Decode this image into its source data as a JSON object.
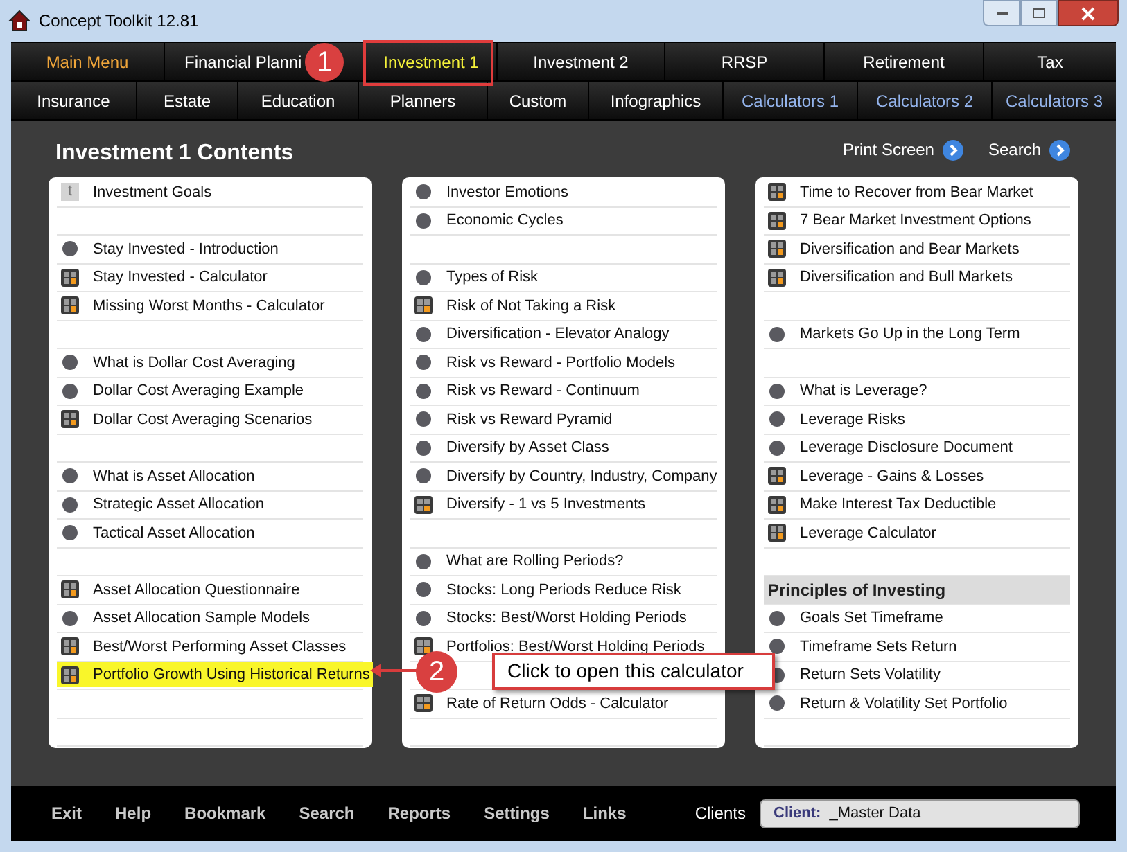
{
  "window": {
    "title": "Concept Toolkit 12.81"
  },
  "tab_rows": [
    [
      {
        "label": "Main Menu",
        "kind": "main",
        "selected": false
      },
      {
        "label": "Financial Planni",
        "kind": "normal",
        "selected": false
      },
      {
        "label": "Investment 1",
        "kind": "normal",
        "selected": true
      },
      {
        "label": "Investment 2",
        "kind": "normal",
        "selected": false
      },
      {
        "label": "RRSP",
        "kind": "normal",
        "selected": false
      },
      {
        "label": "Retirement",
        "kind": "normal",
        "selected": false
      },
      {
        "label": "Tax",
        "kind": "normal",
        "selected": false
      }
    ],
    [
      {
        "label": "Insurance",
        "kind": "normal",
        "selected": false
      },
      {
        "label": "Estate",
        "kind": "normal",
        "selected": false
      },
      {
        "label": "Education",
        "kind": "normal",
        "selected": false
      },
      {
        "label": "Planners",
        "kind": "normal",
        "selected": false
      },
      {
        "label": "Custom",
        "kind": "normal",
        "selected": false
      },
      {
        "label": "Infographics",
        "kind": "normal",
        "selected": false
      },
      {
        "label": "Calculators 1",
        "kind": "calculator",
        "selected": false
      },
      {
        "label": "Calculators 2",
        "kind": "calculator",
        "selected": false
      },
      {
        "label": "Calculators 3",
        "kind": "calculator",
        "selected": false
      }
    ]
  ],
  "content": {
    "title": "Investment 1 Contents",
    "actions": [
      "Print Screen",
      "Search"
    ]
  },
  "columns": [
    [
      {
        "kind": "note",
        "icon_text": "t",
        "label": "Investment Goals",
        "selected": false
      },
      {
        "kind": "blank"
      },
      {
        "kind": "page",
        "label": "Stay Invested - Introduction",
        "selected": false
      },
      {
        "kind": "calculator",
        "label": "Stay Invested - Calculator",
        "selected": false
      },
      {
        "kind": "calculator",
        "label": "Missing Worst Months - Calculator",
        "selected": false
      },
      {
        "kind": "blank"
      },
      {
        "kind": "page",
        "label": "What is Dollar Cost Averaging",
        "selected": false
      },
      {
        "kind": "page",
        "label": "Dollar Cost Averaging Example",
        "selected": false
      },
      {
        "kind": "calculator",
        "label": "Dollar Cost Averaging Scenarios",
        "selected": false
      },
      {
        "kind": "blank"
      },
      {
        "kind": "page",
        "label": "What is Asset Allocation",
        "selected": false
      },
      {
        "kind": "page",
        "label": "Strategic Asset Allocation",
        "selected": false
      },
      {
        "kind": "page",
        "label": "Tactical Asset Allocation",
        "selected": false
      },
      {
        "kind": "blank"
      },
      {
        "kind": "calculator",
        "label": "Asset Allocation Questionnaire",
        "selected": false
      },
      {
        "kind": "page",
        "label": "Asset Allocation Sample Models",
        "selected": false
      },
      {
        "kind": "calculator",
        "label": "Best/Worst Performing Asset Classes",
        "selected": false
      },
      {
        "kind": "calculator",
        "label": "Portfolio Growth Using Historical Returns",
        "selected": true
      },
      {
        "kind": "blank"
      },
      {
        "kind": "blank"
      }
    ],
    [
      {
        "kind": "page",
        "label": "Investor Emotions",
        "selected": false
      },
      {
        "kind": "page",
        "label": "Economic Cycles",
        "selected": false
      },
      {
        "kind": "blank"
      },
      {
        "kind": "page",
        "label": "Types of Risk",
        "selected": false
      },
      {
        "kind": "calculator",
        "label": "Risk of Not Taking a Risk",
        "selected": false
      },
      {
        "kind": "page",
        "label": "Diversification - Elevator Analogy",
        "selected": false
      },
      {
        "kind": "page",
        "label": "Risk vs Reward - Portfolio Models",
        "selected": false
      },
      {
        "kind": "page",
        "label": "Risk vs Reward - Continuum",
        "selected": false
      },
      {
        "kind": "page",
        "label": "Risk vs Reward Pyramid",
        "selected": false
      },
      {
        "kind": "page",
        "label": "Diversify by Asset Class",
        "selected": false
      },
      {
        "kind": "page",
        "label": "Diversify by Country, Industry, Company",
        "selected": false
      },
      {
        "kind": "calculator",
        "label": "Diversify - 1 vs 5 Investments",
        "selected": false
      },
      {
        "kind": "blank"
      },
      {
        "kind": "page",
        "label": "What are Rolling Periods?",
        "selected": false
      },
      {
        "kind": "page",
        "label": "Stocks: Long Periods Reduce Risk",
        "selected": false
      },
      {
        "kind": "page",
        "label": "Stocks: Best/Worst Holding Periods",
        "selected": false
      },
      {
        "kind": "calculator",
        "label": "Portfolios: Best/Worst Holding Periods",
        "selected": false
      },
      {
        "kind": "blank"
      },
      {
        "kind": "calculator",
        "label": "Rate of Return Odds - Calculator",
        "selected": false
      },
      {
        "kind": "blank"
      }
    ],
    [
      {
        "kind": "calculator",
        "label": "Time to Recover from Bear Market",
        "selected": false
      },
      {
        "kind": "calculator",
        "label": "7 Bear Market Investment Options",
        "selected": false
      },
      {
        "kind": "calculator",
        "label": "Diversification and Bear Markets",
        "selected": false
      },
      {
        "kind": "calculator",
        "label": "Diversification and Bull Markets",
        "selected": false
      },
      {
        "kind": "blank"
      },
      {
        "kind": "page",
        "label": "Markets Go Up in the Long Term",
        "selected": false
      },
      {
        "kind": "blank"
      },
      {
        "kind": "page",
        "label": "What is Leverage?",
        "selected": false
      },
      {
        "kind": "page",
        "label": "Leverage Risks",
        "selected": false
      },
      {
        "kind": "page",
        "label": "Leverage Disclosure Document",
        "selected": false
      },
      {
        "kind": "calculator",
        "label": "Leverage - Gains & Losses",
        "selected": false
      },
      {
        "kind": "calculator",
        "label": "Make Interest Tax Deductible",
        "selected": false
      },
      {
        "kind": "calculator",
        "label": "Leverage Calculator",
        "selected": false
      },
      {
        "kind": "blank"
      },
      {
        "kind": "header",
        "label": "Principles of Investing"
      },
      {
        "kind": "page",
        "label": "Goals Set Timeframe",
        "selected": false
      },
      {
        "kind": "page",
        "label": "Timeframe Sets Return",
        "selected": false
      },
      {
        "kind": "page",
        "label": "Return Sets Volatility",
        "selected": false
      },
      {
        "kind": "page",
        "label": "Return & Volatility Set Portfolio",
        "selected": false
      },
      {
        "kind": "blank"
      }
    ]
  ],
  "footer": {
    "links": [
      "Exit",
      "Help",
      "Bookmark",
      "Search",
      "Reports",
      "Settings",
      "Links"
    ],
    "clients_label": "Clients",
    "client_field": {
      "label": "Client:",
      "value": "_Master Data"
    }
  },
  "annotations": [
    {
      "number": "1"
    },
    {
      "number": "2",
      "text": "Click to open this calculator"
    }
  ]
}
